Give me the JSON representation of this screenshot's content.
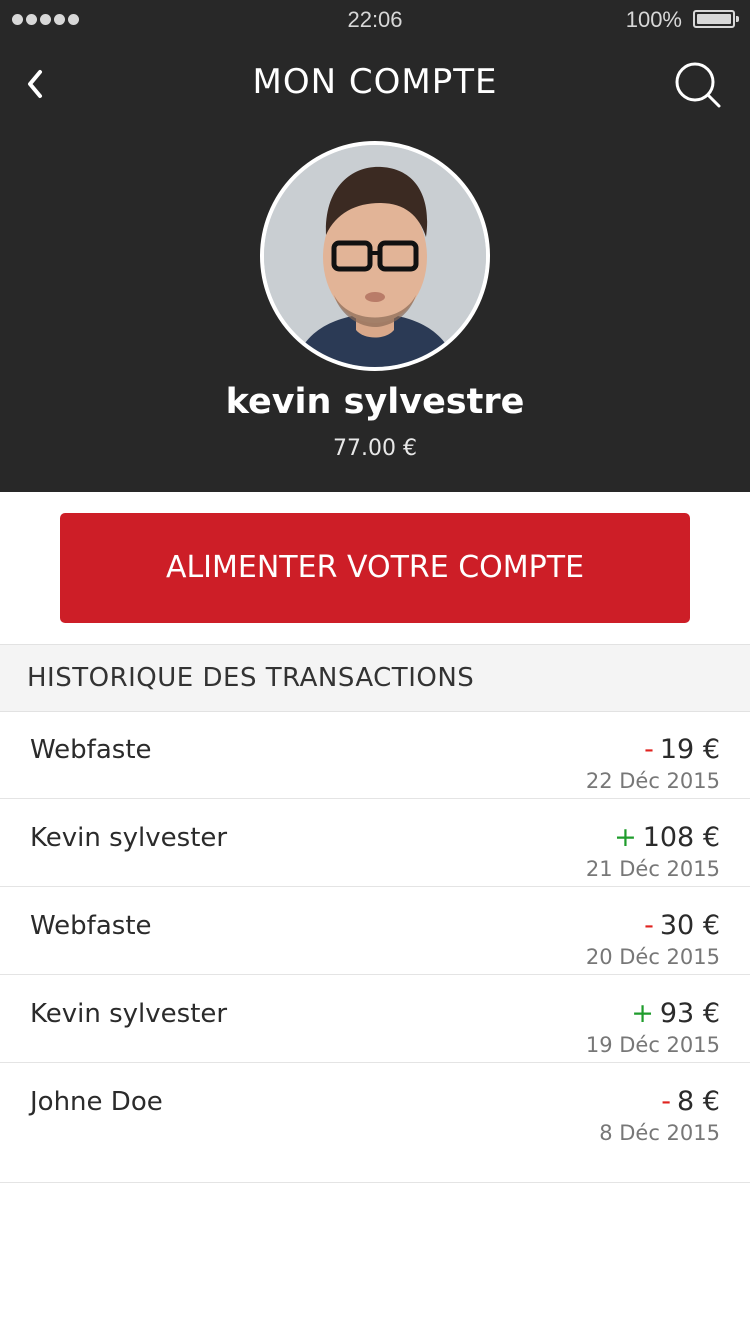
{
  "status_bar": {
    "time": "22:06",
    "battery_percent": "100%",
    "signal_dots": 5
  },
  "header": {
    "title": "MON COMPTE",
    "back_icon": "chevron-left-icon",
    "search_icon": "search-icon"
  },
  "profile": {
    "name": "kevin sylvestre",
    "balance": "77.00 €"
  },
  "actions": {
    "topup_label": "ALIMENTER VOTRE COMPTE"
  },
  "history": {
    "title": "HISTORIQUE DES TRANSACTIONS",
    "transactions": [
      {
        "name": "Webfaste",
        "sign": "-",
        "amount": "19 €",
        "date": "22 Déc 2015"
      },
      {
        "name": "Kevin sylvester",
        "sign": "+",
        "amount": "108 €",
        "date": "21 Déc 2015"
      },
      {
        "name": "Webfaste",
        "sign": "-",
        "amount": "30 €",
        "date": "20 Déc 2015"
      },
      {
        "name": "Kevin sylvester",
        "sign": "+",
        "amount": "93 €",
        "date": "19 Déc 2015"
      },
      {
        "name": "Johne Doe",
        "sign": "-",
        "amount": "8 €",
        "date": "8 Déc 2015"
      }
    ]
  },
  "colors": {
    "header_bg": "#282828",
    "accent_red": "#cd1e27",
    "debit": "#e0231f",
    "credit": "#1f9c2c"
  }
}
